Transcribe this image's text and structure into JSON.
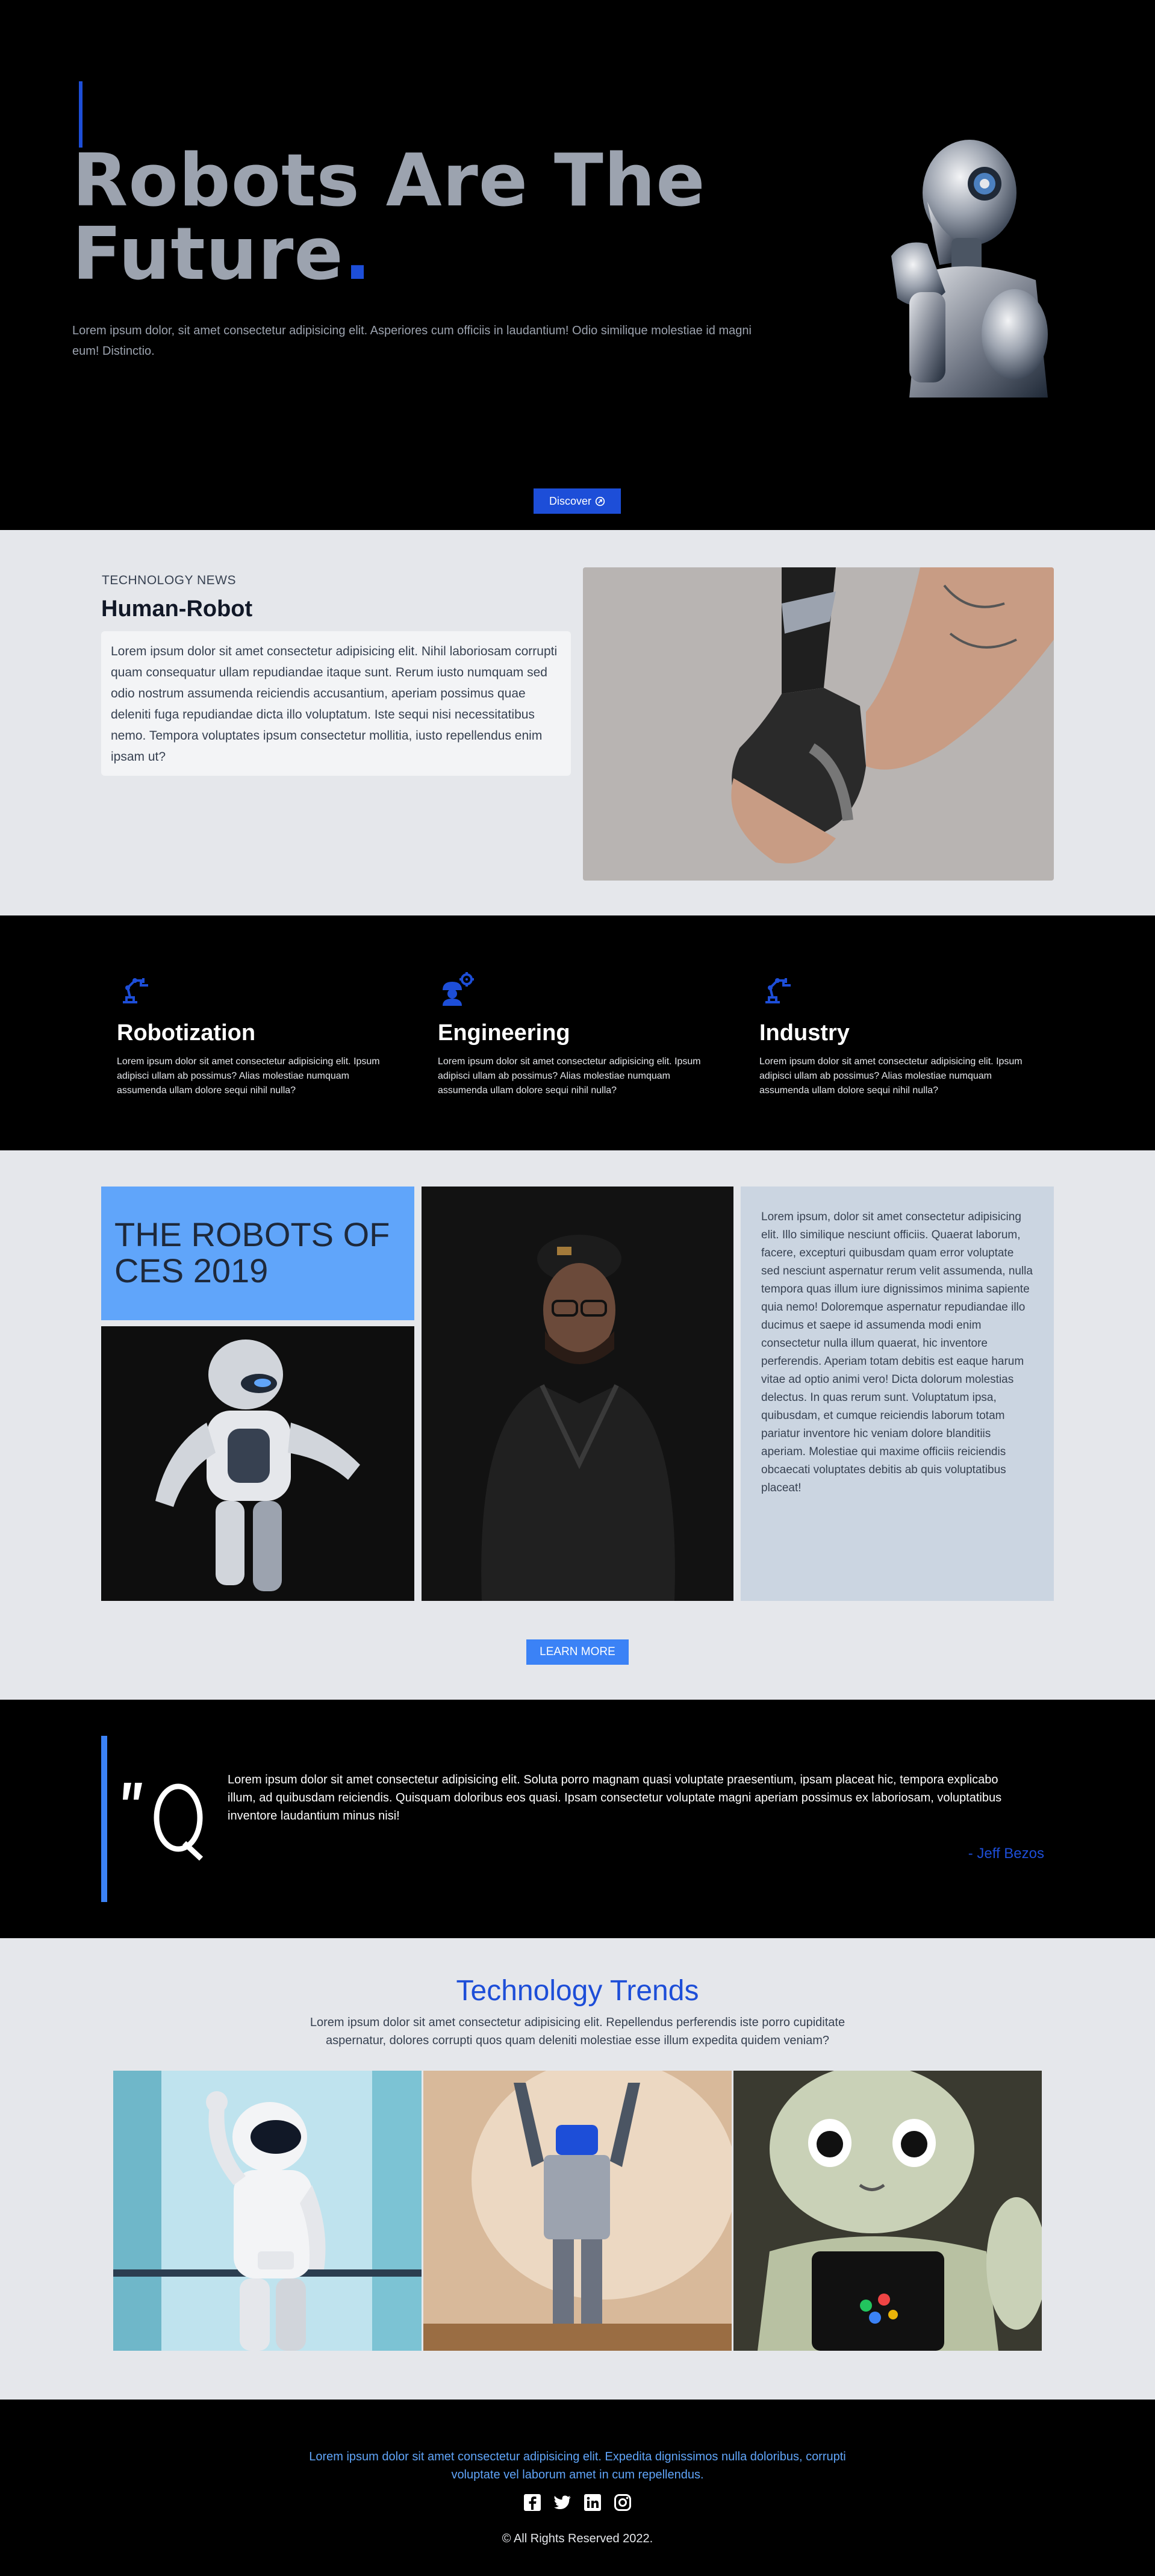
{
  "hero": {
    "title_line1": "Robots Are The",
    "title_line2": "Future",
    "title_dot": ".",
    "description": "Lorem ipsum dolor, sit amet consectetur adipisicing elit. Asperiores cum officiis in laudantium! Odio similique molestiae id magni eum! Distinctio.",
    "discover_label": "Discover",
    "discover_icon": "circle-arrow-icon"
  },
  "news": {
    "kicker": "TECHNOLOGY NEWS",
    "title": "Human-Robot",
    "body": "Lorem ipsum dolor sit amet consectetur adipisicing elit. Nihil laboriosam corrupti quam consequatur ullam repudiandae itaque sunt. Rerum iusto numquam sed odio nostrum assumenda reiciendis accusantium, aperiam possimus quae deleniti fuga repudiandae dicta illo voluptatum. Iste sequi nisi necessitatibus nemo. Tempora voluptates ipsum consectetur mollitia, iusto repellendus enim ipsam ut?"
  },
  "features": [
    {
      "icon": "robot-arm-icon",
      "title": "Robotization",
      "text": "Lorem ipsum dolor sit amet consectetur adipisicing elit. Ipsum adipisci ullam ab possimus? Alias molestiae numquam assumenda ullam dolore sequi nihil nulla?"
    },
    {
      "icon": "engineer-gear-icon",
      "title": "Engineering",
      "text": "Lorem ipsum dolor sit amet consectetur adipisicing elit. Ipsum adipisci ullam ab possimus? Alias molestiae numquam assumenda ullam dolore sequi nihil nulla?"
    },
    {
      "icon": "robot-arm-icon",
      "title": "Industry",
      "text": "Lorem ipsum dolor sit amet consectetur adipisicing elit. Ipsum adipisci ullam ab possimus? Alias molestiae numquam assumenda ullam dolore sequi nihil nulla?"
    }
  ],
  "ces": {
    "heading": "THE ROBOTS OF CES 2019",
    "text": "Lorem ipsum, dolor sit amet consectetur adipisicing elit. Illo similique nesciunt officiis. Quaerat laborum, facere, excepturi quibusdam quam error voluptate sed nesciunt aspernatur rerum velit assumenda, nulla tempora quas illum iure dignissimos minima sapiente quia nemo! Doloremque aspernatur repudiandae illo ducimus et saepe id assumenda modi enim consectetur nulla illum quaerat, hic inventore perferendis. Aperiam totam debitis est eaque harum vitae ad optio animi vero! Dicta dolorum molestias delectus. In quas rerum sunt. Voluptatum ipsa, quibusdam, et cumque reiciendis laborum totam pariatur inventore hic veniam dolore blanditiis aperiam. Molestiae qui maxime officiis reiciendis obcaecati voluptates debitis ab quis voluptatibus placeat!",
    "learn_more": "LEARN MORE"
  },
  "quote": {
    "text": "Lorem ipsum dolor sit amet consectetur adipisicing elit. Soluta porro magnam quasi voluptate praesentium, ipsam placeat hic, tempora explicabo illum, ad quibusdam reiciendis. Quisquam doloribus eos quasi. Ipsam consectetur voluptate magni aperiam possimus ex laboriosam, voluptatibus inventore laudantium minus nisi!",
    "author": "- Jeff Bezos"
  },
  "trends": {
    "title": "Technology Trends",
    "description": "Lorem ipsum dolor sit amet consectetur adipisicing elit. Repellendus perferendis iste porro cupiditate aspernatur, dolores corrupti quos quam deleniti molestiae esse illum expedita quidem veniam?"
  },
  "footer": {
    "text": "Lorem ipsum dolor sit amet consectetur adipisicing elit. Expedita dignissimos nulla doloribus, corrupti voluptate vel laborum amet in cum repellendus.",
    "social": [
      "facebook-icon",
      "twitter-icon",
      "linkedin-icon",
      "instagram-icon"
    ],
    "copyright": "© All Rights Reserved 2022."
  },
  "colors": {
    "accent": "#1d4ed8",
    "accent_light": "#3b82f6",
    "sky": "#60a5fa",
    "light_bg": "#e5e7eb",
    "dark_bg": "#000000",
    "slate_panel": "#cbd5e1"
  }
}
